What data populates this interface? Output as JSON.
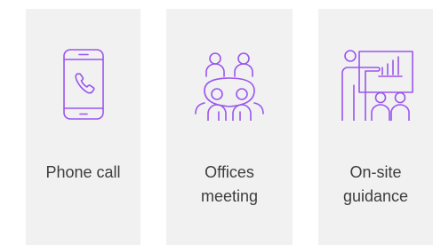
{
  "accent_color": "#9a56ef",
  "cards": [
    {
      "icon": "phone-call-icon",
      "label": "Phone call"
    },
    {
      "icon": "office-meeting-icon",
      "label": "Offices\nmeeting"
    },
    {
      "icon": "onsite-guidance-icon",
      "label": "On-site\nguidance"
    }
  ]
}
